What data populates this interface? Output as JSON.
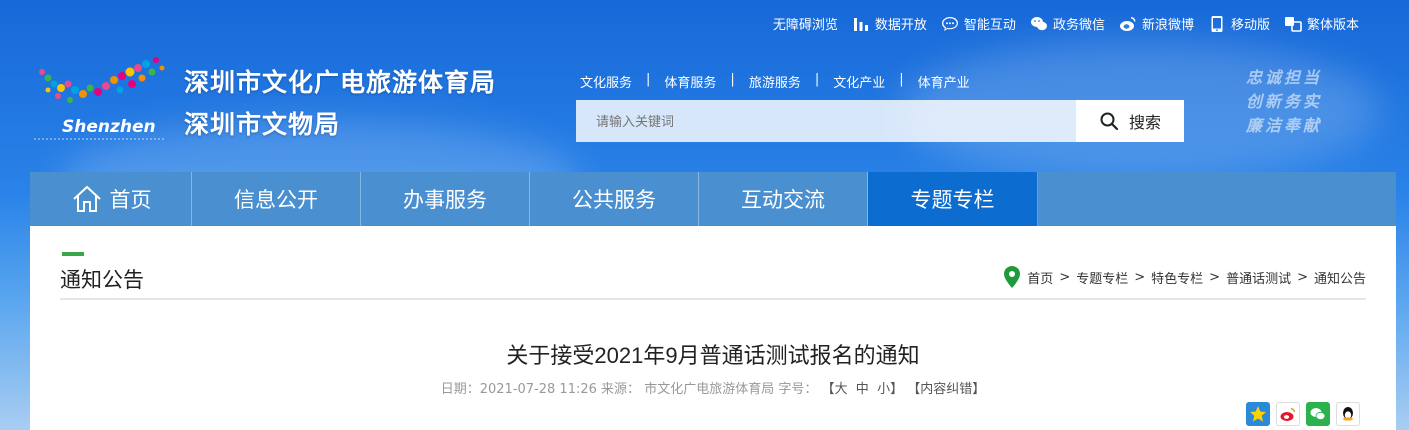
{
  "topbar": [
    {
      "icon": "accessibility",
      "label": "无障碍浏览"
    },
    {
      "icon": "bar-chart-icon",
      "label": "数据开放"
    },
    {
      "icon": "chat-bubble-icon",
      "label": "智能互动"
    },
    {
      "icon": "wechat-icon",
      "label": "政务微信"
    },
    {
      "icon": "weibo-icon",
      "label": "新浪微博"
    },
    {
      "icon": "mobile-icon",
      "label": "移动版"
    },
    {
      "icon": "traditional-chinese-icon",
      "label": "繁体版本"
    }
  ],
  "logo": {
    "text": "Shenzhen"
  },
  "site_title": {
    "line1": "深圳市文化广电旅游体育局",
    "line2": "深圳市文物局"
  },
  "quicklinks": [
    "文化服务",
    "体育服务",
    "旅游服务",
    "文化产业",
    "体育产业"
  ],
  "quicklink_separator": "|",
  "search": {
    "placeholder": "请输入关键词",
    "button_label": "搜索"
  },
  "slogan": [
    "忠诚担当",
    "创新务实",
    "廉洁奉献"
  ],
  "nav": [
    {
      "label": "首页",
      "icon": "home-icon",
      "active": false
    },
    {
      "label": "信息公开",
      "active": false
    },
    {
      "label": "办事服务",
      "active": false
    },
    {
      "label": "公共服务",
      "active": false
    },
    {
      "label": "互动交流",
      "active": false
    },
    {
      "label": "专题专栏",
      "active": true
    }
  ],
  "section": {
    "title": "通知公告"
  },
  "breadcrumb": [
    "首页",
    "专题专栏",
    "特色专栏",
    "普通话测试",
    "通知公告"
  ],
  "breadcrumb_separator": ">",
  "article": {
    "title": "关于接受2021年9月普通话测试报名的通知",
    "date_label": "日期：",
    "date": "2021-07-28 11:26",
    "source_label": "来源：",
    "source": "市文化广电旅游体育局",
    "fontsize_label": "字号：",
    "font_large": "大",
    "font_medium": "中",
    "font_small": "小",
    "correction": "【内容纠错】"
  },
  "share": [
    "qzone-icon",
    "weibo-share-icon",
    "wechat-share-icon",
    "qq-share-icon"
  ],
  "colors": {
    "nav": "#4a8fd0",
    "nav_active": "#0c6ccf",
    "accent_green": "#3aa649"
  }
}
